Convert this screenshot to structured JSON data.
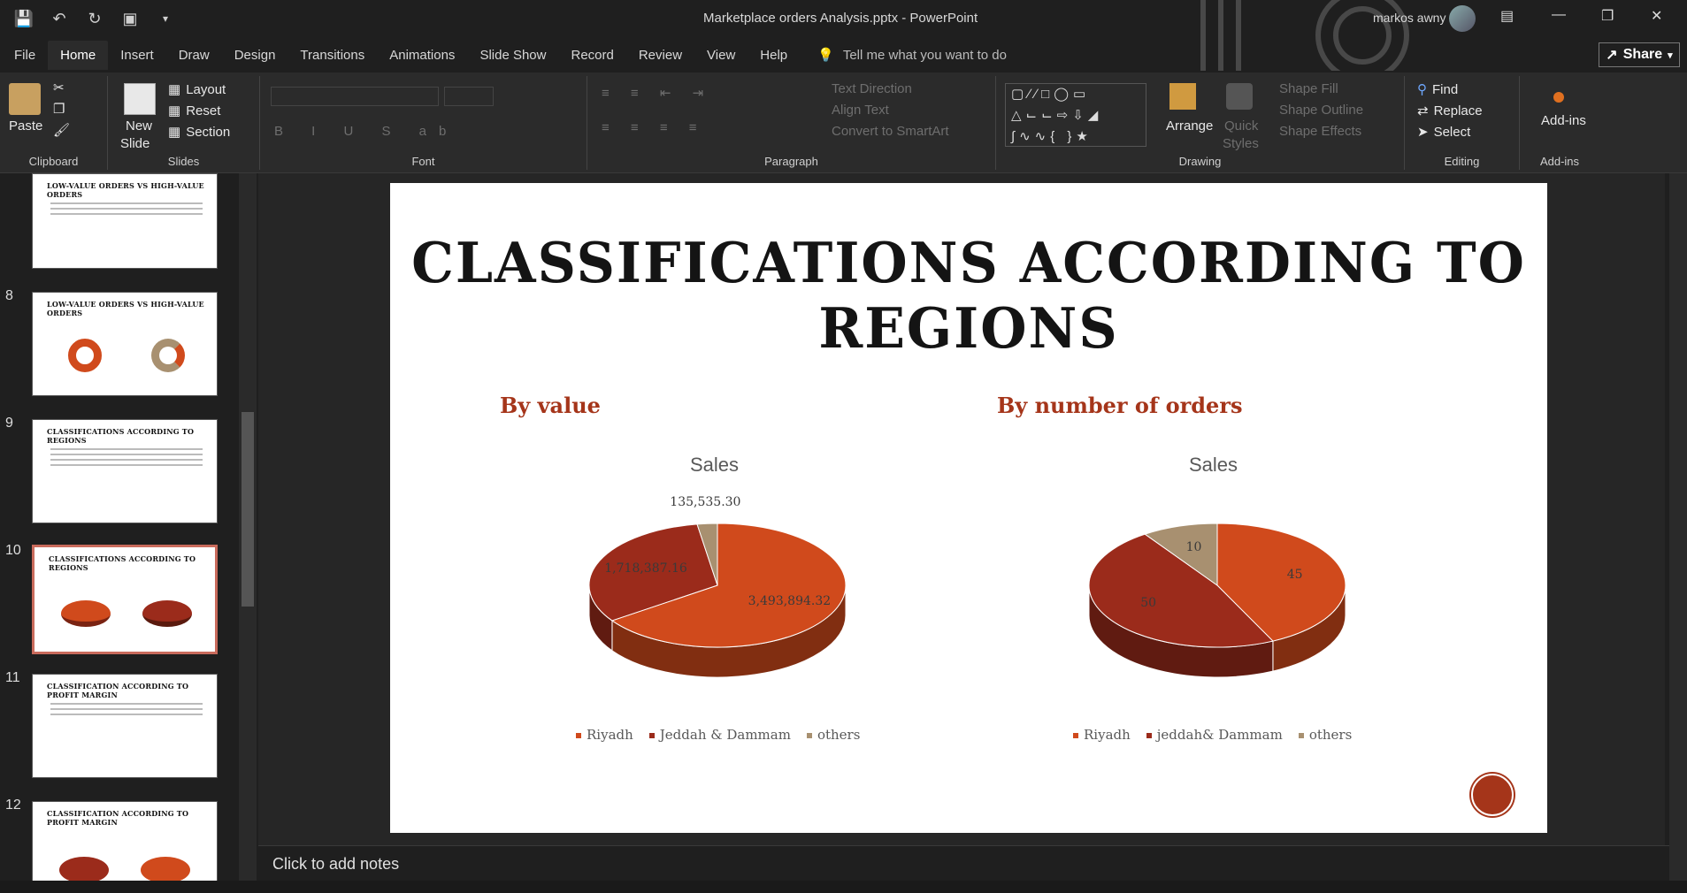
{
  "window": {
    "title": "Marketplace orders Analysis.pptx  -  PowerPoint",
    "user": "markos awny"
  },
  "menu": {
    "tabs": [
      "File",
      "Home",
      "Insert",
      "Draw",
      "Design",
      "Transitions",
      "Animations",
      "Slide Show",
      "Record",
      "Review",
      "View",
      "Help"
    ],
    "active": "Home",
    "tell_me": "Tell me what you want to do",
    "share": "Share"
  },
  "ribbon": {
    "clipboard": {
      "label": "Clipboard",
      "paste": "Paste"
    },
    "slides": {
      "label": "Slides",
      "new_slide_line1": "New",
      "new_slide_line2": "Slide",
      "layout": "Layout",
      "reset": "Reset",
      "section": "Section"
    },
    "font": {
      "label": "Font"
    },
    "paragraph": {
      "label": "Paragraph",
      "text_direction": "Text Direction",
      "align_text": "Align Text",
      "convert_smartart": "Convert to SmartArt"
    },
    "drawing": {
      "label": "Drawing",
      "arrange": "Arrange",
      "quick_styles_1": "Quick",
      "quick_styles_2": "Styles",
      "shape_fill": "Shape Fill",
      "shape_outline": "Shape Outline",
      "shape_effects": "Shape Effects"
    },
    "editing": {
      "label": "Editing",
      "find": "Find",
      "replace": "Replace",
      "select": "Select"
    },
    "addins": {
      "label": "Add-ins",
      "button": "Add-ins"
    }
  },
  "thumbnails": [
    {
      "num": "",
      "title": "LOW-VALUE ORDERS VS HIGH-VALUE ORDERS"
    },
    {
      "num": "8",
      "title": "LOW-VALUE ORDERS VS HIGH-VALUE ORDERS"
    },
    {
      "num": "9",
      "title": "CLASSIFICATIONS ACCORDING TO REGIONS"
    },
    {
      "num": "10",
      "title": "CLASSIFICATIONS ACCORDING TO REGIONS"
    },
    {
      "num": "11",
      "title": "CLASSIFICATION ACCORDING TO PROFIT MARGIN"
    },
    {
      "num": "12",
      "title": "CLASSIFICATION ACCORDING TO PROFIT MARGIN"
    }
  ],
  "slide": {
    "title": "CLASSIFICATIONS ACCORDING TO REGIONS",
    "left_heading": "By value",
    "right_heading": "By number of orders"
  },
  "notes": "Click to add notes",
  "colors": {
    "riyadh": "#d04a1c",
    "jeddah": "#9b2b1b",
    "others": "#a89070",
    "accent": "#a5351a"
  },
  "chart_data": [
    {
      "type": "pie",
      "title": "Sales",
      "categories": [
        "Riyadh",
        "Jeddah & Dammam",
        "others"
      ],
      "values": [
        3493894.32,
        1718387.16,
        135535.3
      ],
      "data_labels": [
        "3,493,894.32",
        "1,718,387.16",
        "135,535.30"
      ]
    },
    {
      "type": "pie",
      "title": "Sales",
      "categories": [
        "Riyadh",
        "jeddah& Dammam",
        "others"
      ],
      "values": [
        45,
        50,
        10
      ],
      "data_labels": [
        "45",
        "50",
        "10"
      ]
    }
  ]
}
